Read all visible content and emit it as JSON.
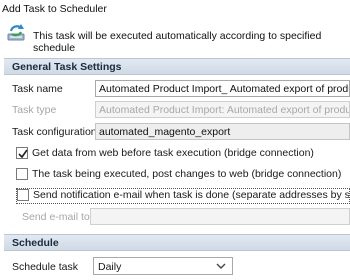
{
  "window": {
    "title": "Add Task to Scheduler"
  },
  "info": {
    "icon": "scheduler-refresh-icon",
    "text": "This task will be executed automatically according to specified schedule"
  },
  "general": {
    "header": "General Task Settings",
    "task_name_label": "Task name",
    "task_name_value": "Automated Product Import_ Automated export of products",
    "task_type_label": "Task type",
    "task_type_value": "Automated Product Import: Automated export of products",
    "task_config_label": "Task configuration",
    "task_config_value": "automated_magento_export",
    "checkbox_get_data": {
      "label": "Get data from web before task execution (bridge connection)",
      "checked": true
    },
    "checkbox_post_changes": {
      "label": "The task being executed, post changes to web (bridge connection)",
      "checked": false
    },
    "checkbox_notify": {
      "label": "Send notification e-mail when task is done (separate addresses by semicolon)",
      "checked": false
    },
    "send_email_label": "Send e-mail to",
    "send_email_value": ""
  },
  "schedule": {
    "header": "Schedule",
    "schedule_task_label": "Schedule task",
    "schedule_task_value": "Daily"
  },
  "colors": {
    "header_bg": "#d6dfea",
    "accent": "#2e8bc9"
  }
}
